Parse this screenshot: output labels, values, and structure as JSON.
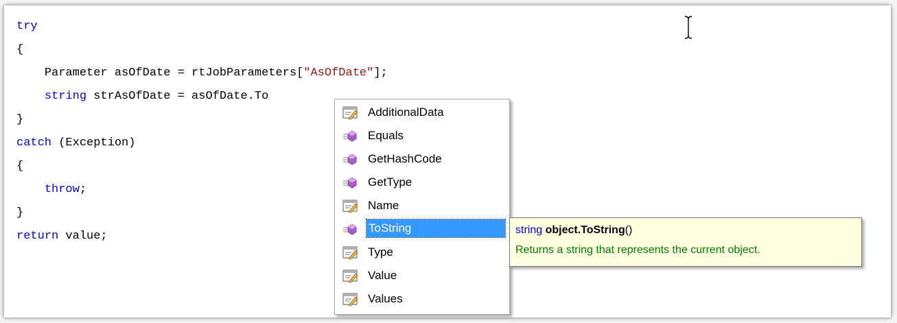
{
  "code": {
    "l1": {
      "kw": "try"
    },
    "l2": {
      "text": "{"
    },
    "l3": {
      "indent": "    ",
      "a": "Parameter asOfDate = rtJobParameters[",
      "str": "\"AsOfDate\"",
      "b": "];"
    },
    "l4": {
      "indent": "    ",
      "kw": "string",
      "a": " strAsOfDate = asOfDate.To"
    },
    "l5": {
      "text": "}"
    },
    "l6": {
      "kw": "catch",
      "a": " (Exception)"
    },
    "l7": {
      "text": "{"
    },
    "l8": {
      "indent": "    ",
      "kw": "throw",
      "a": ";"
    },
    "l9": {
      "text": "}"
    },
    "l10": {
      "kw": "return",
      "a": " value;"
    }
  },
  "completion_list": {
    "selected_index": 5,
    "items": [
      {
        "label": "AdditionalData",
        "icon": "property-icon"
      },
      {
        "label": "Equals",
        "icon": "method-icon"
      },
      {
        "label": "GetHashCode",
        "icon": "method-icon"
      },
      {
        "label": "GetType",
        "icon": "method-icon"
      },
      {
        "label": "Name",
        "icon": "property-icon"
      },
      {
        "label": "ToString",
        "icon": "method-icon"
      },
      {
        "label": "Type",
        "icon": "property-icon"
      },
      {
        "label": "Value",
        "icon": "property-icon"
      },
      {
        "label": "Values",
        "icon": "property-icon"
      }
    ]
  },
  "tooltip": {
    "type": "string",
    "member": "object.ToString",
    "parens": "()",
    "description": "Returns a string that represents the current object."
  },
  "colors": {
    "keyword": "#0000ff",
    "string_literal": "#a31515",
    "selection": "#3399ff",
    "tooltip_bg": "#ffffe1",
    "tooltip_desc": "#008000"
  }
}
